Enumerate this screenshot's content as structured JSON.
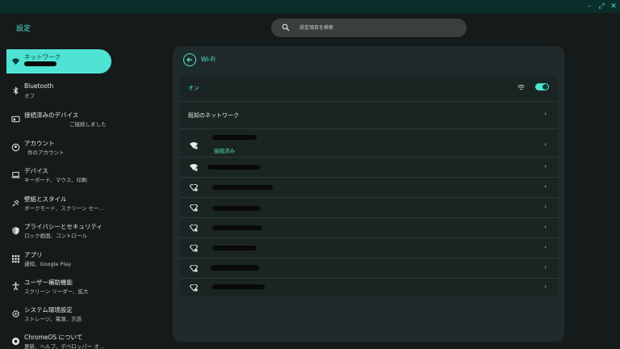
{
  "app_title": "設定",
  "search": {
    "placeholder": "設定項目を検索"
  },
  "window_controls": {
    "minimize": "–",
    "maximize": "⤢",
    "close": "✕"
  },
  "nav": {
    "items": [
      {
        "label": "ネットワーク",
        "sub": "",
        "icon": "wifi-icon",
        "active": true
      },
      {
        "label": "Bluetooth",
        "sub": "オフ",
        "icon": "bluetooth-icon"
      },
      {
        "label": "接続済みのデバイス",
        "sub": "ご接続しました",
        "icon": "phone-hub-icon"
      },
      {
        "label": "アカウント",
        "sub": "件のアカウント",
        "icon": "account-icon"
      },
      {
        "label": "デバイス",
        "sub": "キーボード、マウス、印刷",
        "icon": "laptop-icon"
      },
      {
        "label": "壁紙とスタイル",
        "sub": "ダークモード、スクリーン セー…",
        "icon": "palette-icon"
      },
      {
        "label": "プライバシーとセキュリティ",
        "sub": "ロック画面、コントロール",
        "icon": "shield-icon"
      },
      {
        "label": "アプリ",
        "sub": "通知、Google Play",
        "icon": "apps-grid-icon"
      },
      {
        "label": "ユーザー補助機能",
        "sub": "スクリーン リーダー、拡大",
        "icon": "accessibility-icon"
      },
      {
        "label": "システム環境設定",
        "sub": "ストレージ、電源、言語",
        "icon": "gear-icon"
      },
      {
        "label": "ChromeOS について",
        "sub": "更新、ヘルプ、デベロッパー オ…",
        "icon": "chromeos-icon"
      }
    ]
  },
  "panel": {
    "title": "Wi-Fi",
    "wifi_toggle_label": "オン",
    "wifi_enabled": true,
    "known_networks_label": "既知のネットワーク",
    "connected_label": "接続済み",
    "chevron": "›"
  },
  "colors": {
    "accent": "#4fe3d3",
    "background": "#151a1a",
    "panel": "#1f2b2a",
    "connected_text": "#58e0b4"
  }
}
